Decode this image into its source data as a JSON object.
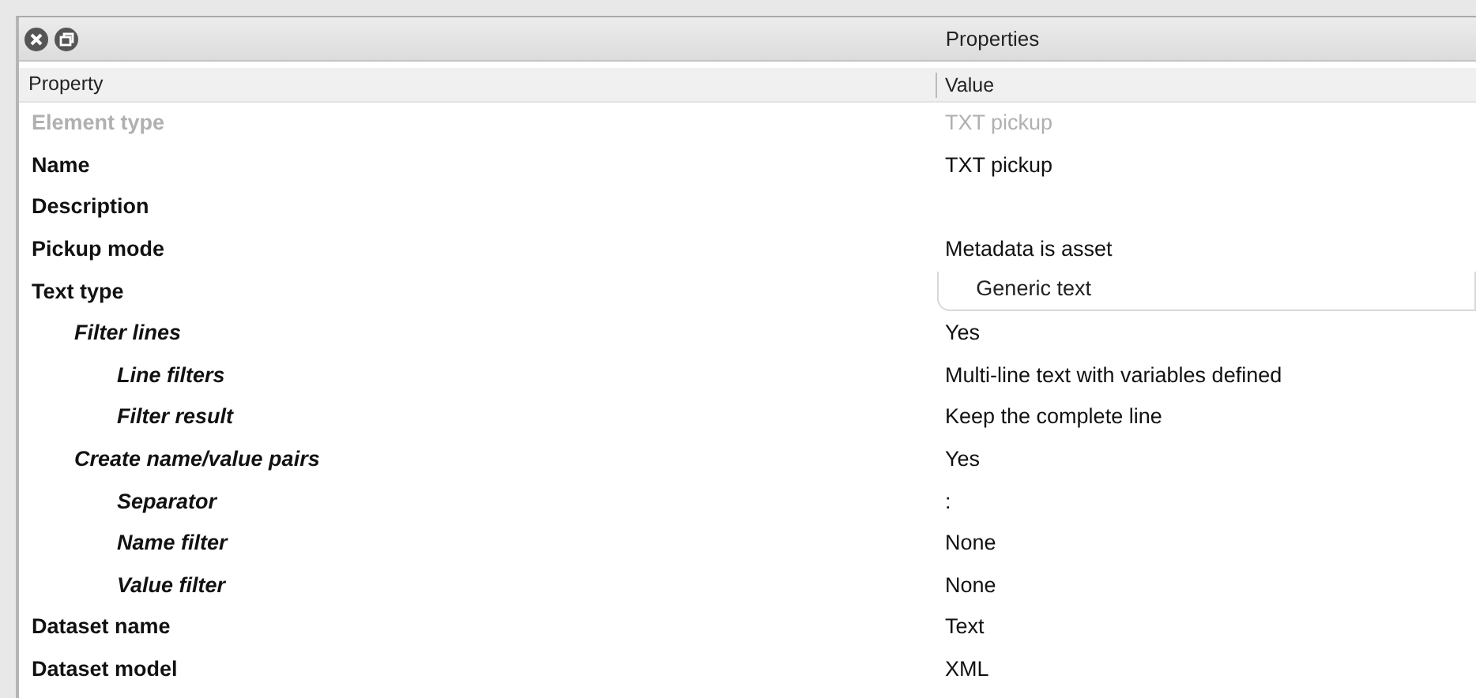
{
  "window": {
    "title": "Properties",
    "buttons": [
      {
        "kind": "close"
      },
      {
        "kind": "restore"
      }
    ]
  },
  "table": {
    "columns": [
      "Property",
      "Value"
    ],
    "rows": [
      {
        "property": "Element type",
        "value": "TXT pickup",
        "kind": "text",
        "disabled": true
      },
      {
        "property": "Name",
        "value": "TXT pickup",
        "kind": "text",
        "disabled": false
      },
      {
        "property": "Description",
        "disabled": false
      },
      {
        "property": "Pickup mode",
        "value": "Metadata is asset",
        "kind": "text",
        "disabled": false
      },
      {
        "property": "Text type",
        "value": "Generic text",
        "kind": "dropdown",
        "disabled": false,
        "children": [
          {
            "property": "Filter lines",
            "value": "Yes",
            "kind": "text",
            "disabled": false,
            "children": [
              {
                "property": "Line filters",
                "value": "Multi-line text with variables defined",
                "kind": "text",
                "disabled": false
              },
              {
                "property": "Filter result",
                "value": "Keep the complete line",
                "kind": "text",
                "disabled": false
              }
            ]
          },
          {
            "property": "Create name/value pairs",
            "value": "Yes",
            "kind": "text",
            "disabled": false,
            "children": [
              {
                "property": "Separator",
                "value": ":",
                "kind": "text",
                "disabled": false
              },
              {
                "property": "Name filter",
                "value": "None",
                "kind": "text",
                "disabled": false
              },
              {
                "property": "Value filter",
                "value": "None",
                "kind": "text",
                "disabled": false
              }
            ]
          }
        ]
      },
      {
        "property": "Dataset name",
        "value": "Text",
        "kind": "text",
        "disabled": false
      },
      {
        "property": "Dataset model",
        "value": "XML",
        "kind": "text",
        "disabled": false
      }
    ]
  }
}
